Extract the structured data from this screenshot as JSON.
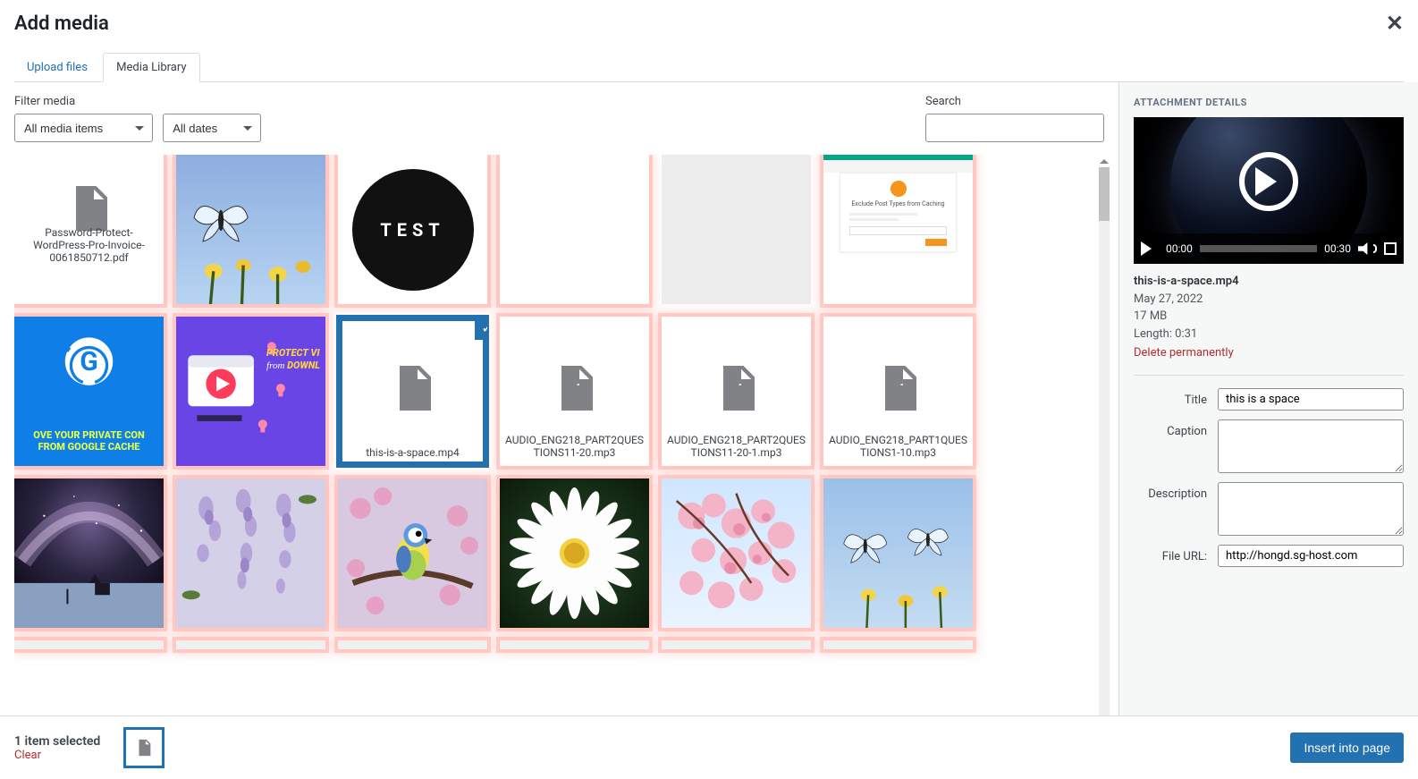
{
  "modal": {
    "title": "Add media",
    "tabs": {
      "upload": "Upload files",
      "library": "Media Library"
    },
    "close_aria": "Close"
  },
  "toolbar": {
    "filter_label": "Filter media",
    "filter_all": "All media items",
    "filter_dates": "All dates",
    "search_label": "Search"
  },
  "items": {
    "pdf_name": "Password-Protect-WordPress-Pro-Invoice-0061850712.pdf",
    "butterfly1_alt": "butterfly on yellow flowers",
    "test_circle": "TEST",
    "blank_alt": "blank",
    "gray_alt": "placeholder",
    "exclude_card_title": "Exclude Post Types from Caching",
    "gcache_line1": "OVE YOUR PRIVATE CON",
    "gcache_line2": "FROM GOOGLE CACHE",
    "protect_line1": "PROTECT VI",
    "protect_line2": "from",
    "protect_line3": "DOWNL",
    "selected_video": "this-is-a-space.mp4",
    "audio1": "AUDIO_ENG218_PART2QUESTIONS11-20.mp3",
    "audio2": "AUDIO_ENG218_PART2QUESTIONS11-20-1.mp3",
    "audio3": "AUDIO_ENG218_PART1QUESTIONS1-10.mp3",
    "galaxy_alt": "milky way over hut",
    "wisteria_alt": "wisteria flowers",
    "bird_alt": "blue tit bird on branch",
    "daisy_alt": "white daisy flower",
    "cherry_alt": "cherry blossoms",
    "butterfly2_alt": "two butterflies on flowers"
  },
  "sidebar": {
    "heading": "ATTACHMENT DETAILS",
    "video_time_start": "00:00",
    "video_time_end": "00:30",
    "filename": "this-is-a-space.mp4",
    "date": "May 27, 2022",
    "size": "17 MB",
    "length_label": "Length: 0:31",
    "delete": "Delete permanently",
    "title_label": "Title",
    "title_value": "this is a space",
    "caption_label": "Caption",
    "description_label": "Description",
    "fileurl_label": "File URL:",
    "fileurl_value": "http://hongd.sg-host.com"
  },
  "footer": {
    "selected_text": "1 item selected",
    "clear": "Clear",
    "insert": "Insert into page"
  }
}
